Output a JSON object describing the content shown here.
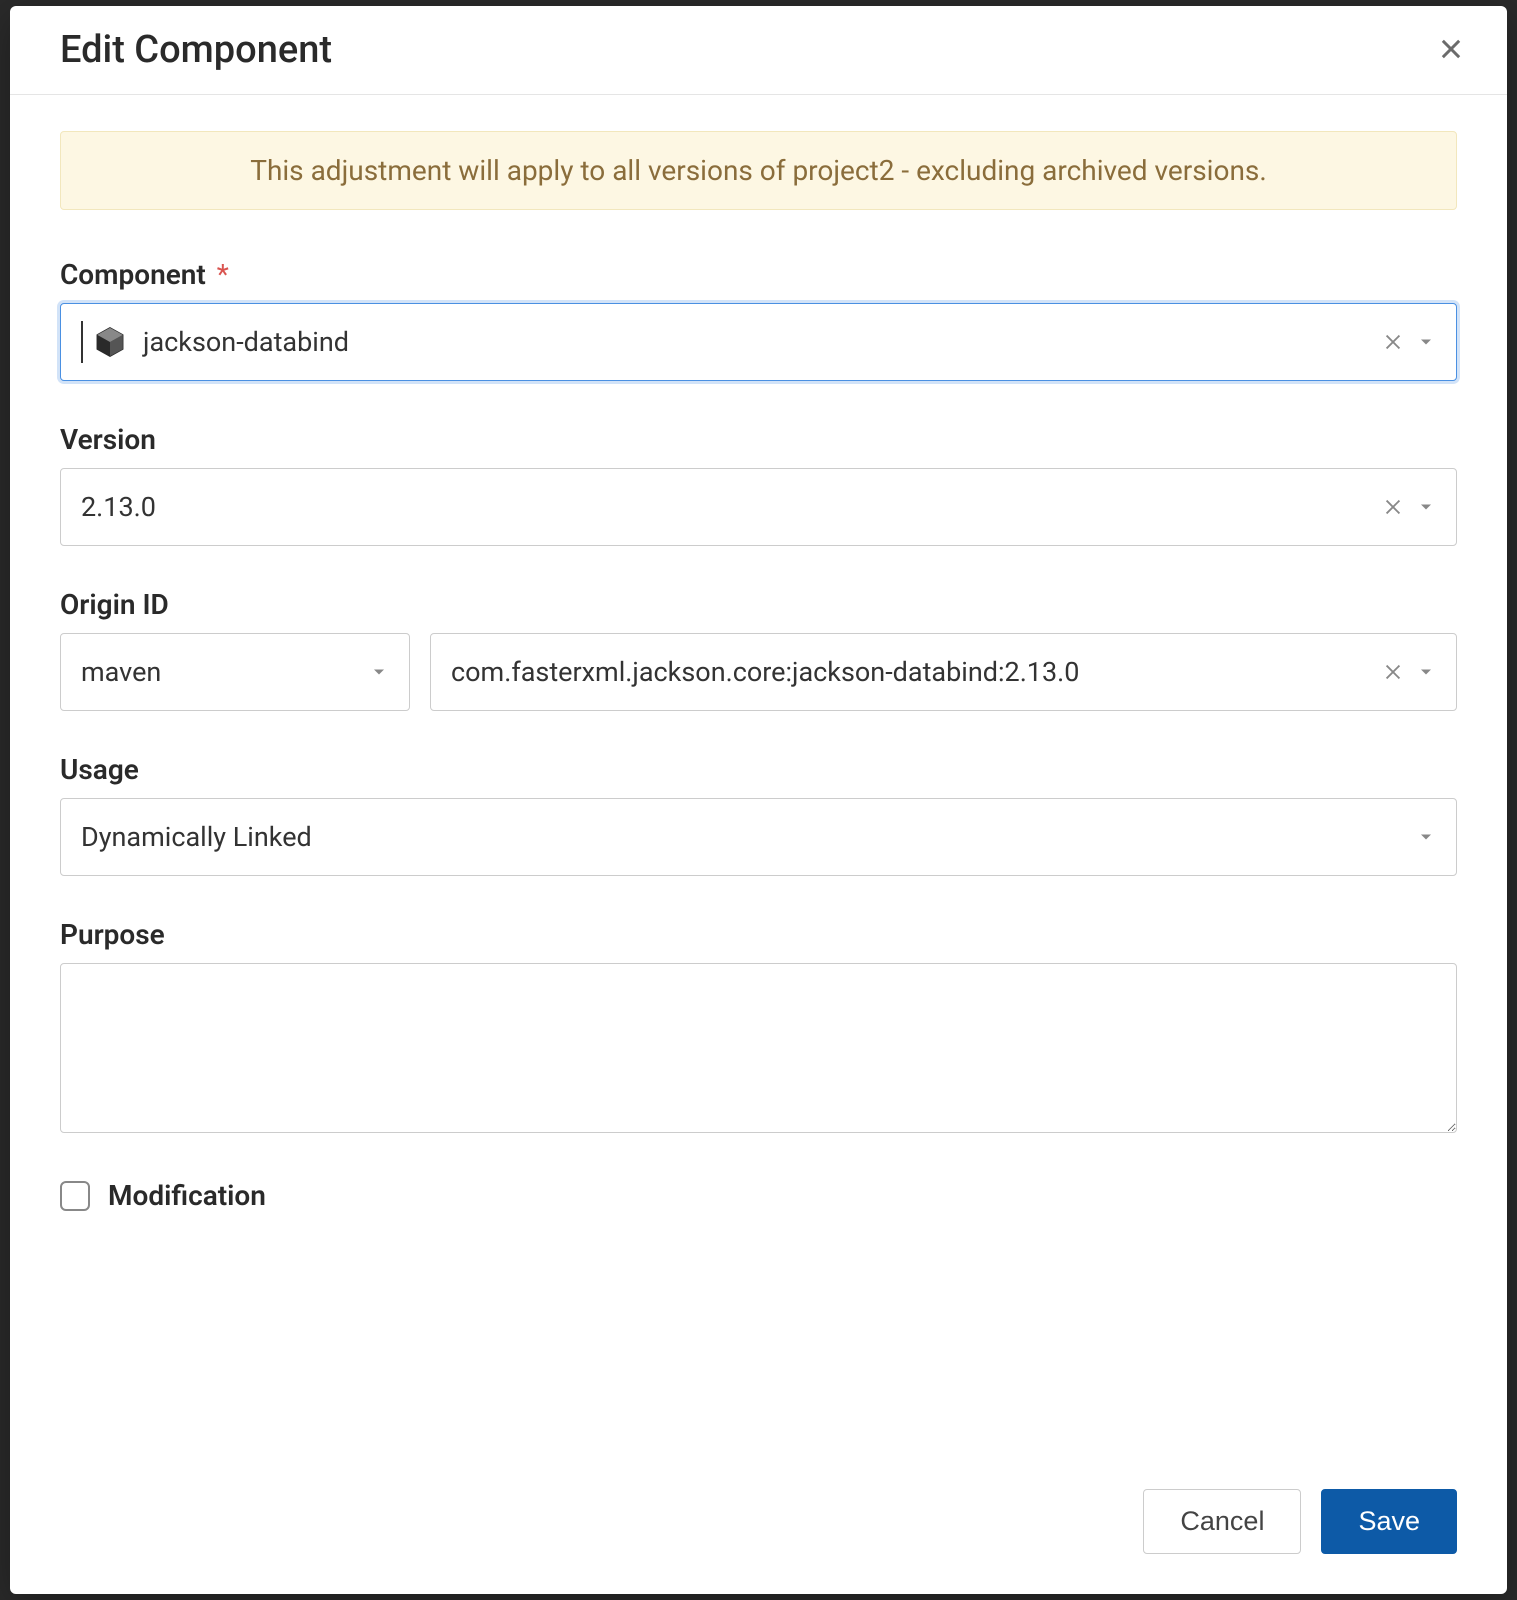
{
  "modal": {
    "title": "Edit Component",
    "alert": "This adjustment will apply to all versions of project2 - excluding archived versions."
  },
  "fields": {
    "component": {
      "label": "Component",
      "required": true,
      "value": "jackson-databind"
    },
    "version": {
      "label": "Version",
      "value": "2.13.0"
    },
    "origin": {
      "label": "Origin ID",
      "type_value": "maven",
      "id_value": "com.fasterxml.jackson.core:jackson-databind:2.13.0"
    },
    "usage": {
      "label": "Usage",
      "value": "Dynamically Linked"
    },
    "purpose": {
      "label": "Purpose",
      "value": ""
    },
    "modification": {
      "label": "Modification",
      "checked": false
    }
  },
  "footer": {
    "cancel": "Cancel",
    "save": "Save"
  }
}
